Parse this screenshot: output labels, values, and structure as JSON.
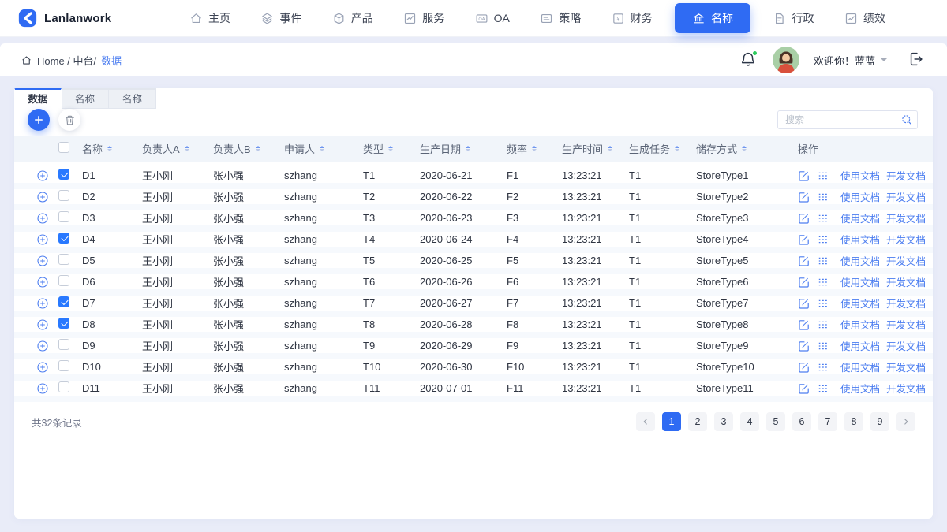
{
  "brand": {
    "name": "Lanlanwork"
  },
  "nav": {
    "items": [
      {
        "label": "主页",
        "icon": "home-icon",
        "active": false
      },
      {
        "label": "事件",
        "icon": "layers-icon",
        "active": false
      },
      {
        "label": "产品",
        "icon": "product-icon",
        "active": false
      },
      {
        "label": "服务",
        "icon": "chart-icon",
        "active": false
      },
      {
        "label": "OA",
        "icon": "oa-icon",
        "active": false
      },
      {
        "label": "策略",
        "icon": "strategy-icon",
        "active": false
      },
      {
        "label": "财务",
        "icon": "finance-icon",
        "active": false
      },
      {
        "label": "名称",
        "icon": "bank-icon",
        "active": true
      },
      {
        "label": "行政",
        "icon": "admin-icon",
        "active": false
      },
      {
        "label": "绩效",
        "icon": "performance-icon",
        "active": false
      }
    ]
  },
  "breadcrumb": {
    "path": "Home / 中台/",
    "current": "数据"
  },
  "header_right": {
    "welcome": "欢迎你！蓝蓝"
  },
  "tabs": [
    {
      "label": "数据",
      "active": true
    },
    {
      "label": "名称",
      "active": false
    },
    {
      "label": "名称",
      "active": false
    }
  ],
  "toolbar": {
    "search_placeholder": "搜索"
  },
  "table": {
    "columns": [
      "名称",
      "负责人A",
      "负责人B",
      "申请人",
      "类型",
      "生产日期",
      "频率",
      "生产时间",
      "生成任务",
      "储存方式"
    ],
    "ops_label": "操作",
    "action_links": [
      "使用文档",
      "开发文档"
    ],
    "rows": [
      {
        "checked": true,
        "name": "D1",
        "owner_a": "王小刚",
        "owner_b": "张小强",
        "applicant": "szhang",
        "type": "T1",
        "date": "2020-06-21",
        "freq": "F1",
        "time": "13:23:21",
        "task": "T1",
        "store": "StoreType1"
      },
      {
        "checked": false,
        "name": "D2",
        "owner_a": "王小刚",
        "owner_b": "张小强",
        "applicant": "szhang",
        "type": "T2",
        "date": "2020-06-22",
        "freq": "F2",
        "time": "13:23:21",
        "task": "T1",
        "store": "StoreType2"
      },
      {
        "checked": false,
        "name": "D3",
        "owner_a": "王小刚",
        "owner_b": "张小强",
        "applicant": "szhang",
        "type": "T3",
        "date": "2020-06-23",
        "freq": "F3",
        "time": "13:23:21",
        "task": "T1",
        "store": "StoreType3"
      },
      {
        "checked": true,
        "name": "D4",
        "owner_a": "王小刚",
        "owner_b": "张小强",
        "applicant": "szhang",
        "type": "T4",
        "date": "2020-06-24",
        "freq": "F4",
        "time": "13:23:21",
        "task": "T1",
        "store": "StoreType4"
      },
      {
        "checked": false,
        "name": "D5",
        "owner_a": "王小刚",
        "owner_b": "张小强",
        "applicant": "szhang",
        "type": "T5",
        "date": "2020-06-25",
        "freq": "F5",
        "time": "13:23:21",
        "task": "T1",
        "store": "StoreType5"
      },
      {
        "checked": false,
        "name": "D6",
        "owner_a": "王小刚",
        "owner_b": "张小强",
        "applicant": "szhang",
        "type": "T6",
        "date": "2020-06-26",
        "freq": "F6",
        "time": "13:23:21",
        "task": "T1",
        "store": "StoreType6"
      },
      {
        "checked": true,
        "name": "D7",
        "owner_a": "王小刚",
        "owner_b": "张小强",
        "applicant": "szhang",
        "type": "T7",
        "date": "2020-06-27",
        "freq": "F7",
        "time": "13:23:21",
        "task": "T1",
        "store": "StoreType7"
      },
      {
        "checked": true,
        "name": "D8",
        "owner_a": "王小刚",
        "owner_b": "张小强",
        "applicant": "szhang",
        "type": "T8",
        "date": "2020-06-28",
        "freq": "F8",
        "time": "13:23:21",
        "task": "T1",
        "store": "StoreType8"
      },
      {
        "checked": false,
        "name": "D9",
        "owner_a": "王小刚",
        "owner_b": "张小强",
        "applicant": "szhang",
        "type": "T9",
        "date": "2020-06-29",
        "freq": "F9",
        "time": "13:23:21",
        "task": "T1",
        "store": "StoreType9"
      },
      {
        "checked": false,
        "name": "D10",
        "owner_a": "王小刚",
        "owner_b": "张小强",
        "applicant": "szhang",
        "type": "T10",
        "date": "2020-06-30",
        "freq": "F10",
        "time": "13:23:21",
        "task": "T1",
        "store": "StoreType10"
      },
      {
        "checked": false,
        "name": "D11",
        "owner_a": "王小刚",
        "owner_b": "张小强",
        "applicant": "szhang",
        "type": "T11",
        "date": "2020-07-01",
        "freq": "F11",
        "time": "13:23:21",
        "task": "T1",
        "store": "StoreType11"
      }
    ]
  },
  "footer": {
    "total": "共32条记录",
    "pages": [
      {
        "label": "1",
        "active": true
      },
      {
        "label": "2",
        "active": false
      },
      {
        "label": "3",
        "active": false
      },
      {
        "label": "4",
        "active": false
      },
      {
        "label": "5",
        "active": false
      },
      {
        "label": "6",
        "active": false
      },
      {
        "label": "7",
        "active": false
      },
      {
        "label": "8",
        "active": false
      },
      {
        "label": "9",
        "active": false
      }
    ]
  },
  "colors": {
    "accent": "#2f6bf3",
    "link": "#4a7cf0",
    "checkbox_checked": "#2979ff",
    "notification_dot": "#2ecc5e",
    "page_background": "#e9ecf8"
  }
}
